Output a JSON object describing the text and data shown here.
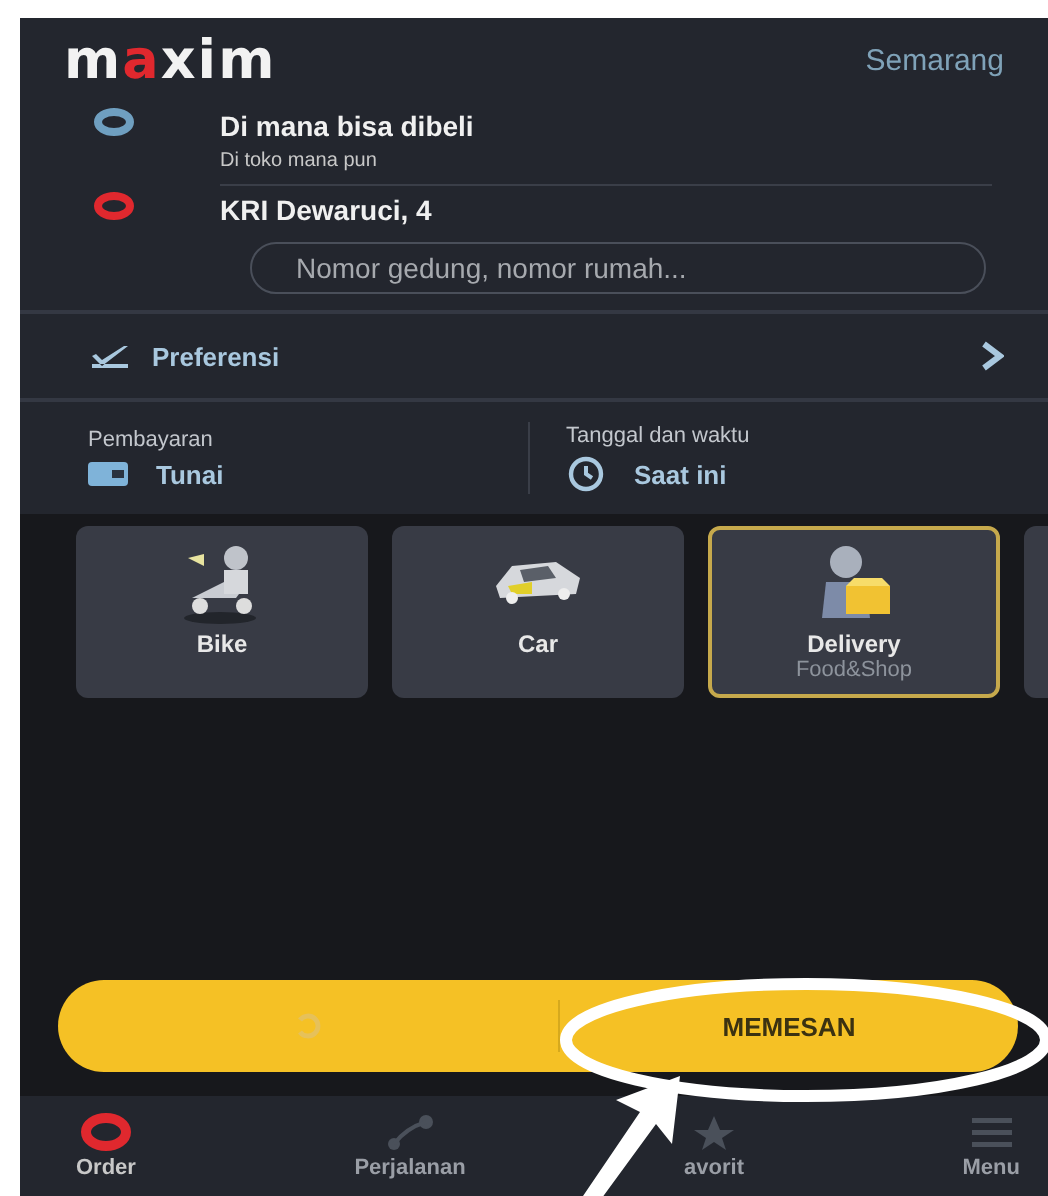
{
  "header": {
    "logo": "maxim",
    "city": "Semarang"
  },
  "route": [
    {
      "title": "Di mana bisa dibeli",
      "subtitle": "Di toko mana pun",
      "color": "#6f9fc0"
    },
    {
      "title": "KRI Dewaruci, 4",
      "color": "#e0282e"
    }
  ],
  "address_field": {
    "placeholder": "Nomor gedung, nomor rumah..."
  },
  "preferences": {
    "label": "Preferensi"
  },
  "payment": {
    "label": "Pembayaran",
    "value": "Tunai"
  },
  "datetime": {
    "label": "Tanggal dan waktu",
    "value": "Saat ini"
  },
  "services": [
    {
      "kind": "bike",
      "label": "Bike",
      "selected": false
    },
    {
      "kind": "car",
      "label": "Car",
      "selected": false
    },
    {
      "kind": "delivery",
      "label": "Delivery",
      "subtitle": "Food&Shop",
      "selected": true
    }
  ],
  "order_button": {
    "label": "MEMESAN"
  },
  "bottom_nav": [
    {
      "kind": "order",
      "label": "Order",
      "selected": true
    },
    {
      "kind": "trips",
      "label": "Perjalanan",
      "selected": false
    },
    {
      "kind": "favorites",
      "label": "avorit",
      "selected": false
    },
    {
      "kind": "menu",
      "label": "Menu",
      "selected": false
    }
  ]
}
